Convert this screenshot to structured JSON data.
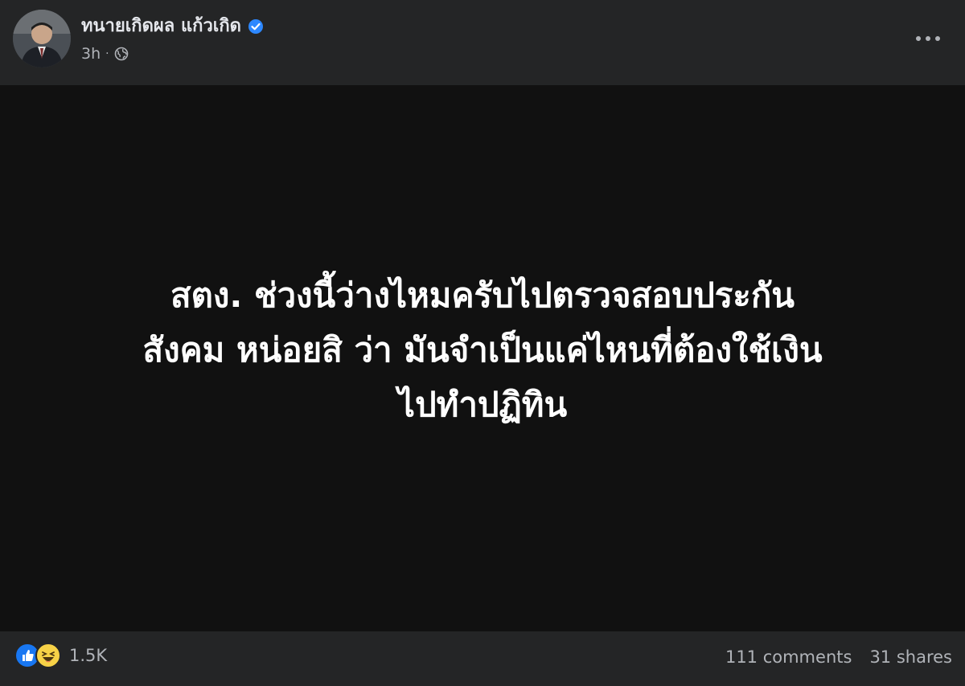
{
  "post": {
    "author": "ทนายเกิดผล แก้วเกิด",
    "verified": true,
    "timestamp": "3h",
    "privacy_icon": "globe-icon",
    "text_lines": [
      "สตง. ช่วงนี้ว่างไหมครับไปตรวจสอบประกัน",
      "สังคม หน่อยสิ ว่า มันจำเป็นแค่ไหนที่ต้องใช้เงิน",
      "ไปทำปฏิทิน"
    ],
    "background_color": "#111111"
  },
  "footer": {
    "reaction_icons": [
      "like-icon",
      "haha-icon"
    ],
    "reaction_count": "1.5K",
    "comments": "111 comments",
    "shares": "31 shares"
  },
  "colors": {
    "surface": "#242526",
    "primary_text": "#e4e6eb",
    "secondary_text": "#b0b3b8",
    "verified_blue": "#2d88ff",
    "like_blue": "#1877f2",
    "haha_yellow": "#f7d247"
  }
}
